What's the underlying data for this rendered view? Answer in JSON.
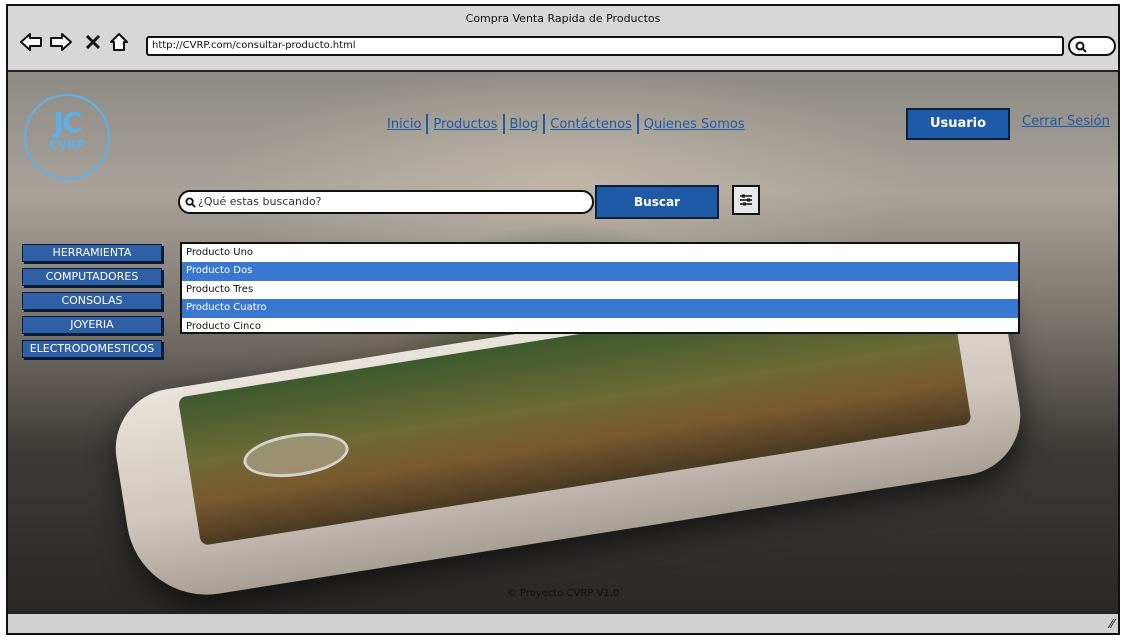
{
  "window": {
    "title": "Compra Venta Rapida de Productos"
  },
  "browser": {
    "url": "http://CVRP.com/consultar-producto.html",
    "icons": [
      "back-arrow-icon",
      "forward-arrow-icon",
      "close-x-icon",
      "home-icon",
      "search-icon"
    ]
  },
  "logo": {
    "mark": "JC",
    "text": "CVRP"
  },
  "nav": {
    "items": [
      "Inicio",
      "Productos",
      "Blog",
      "Contáctenos",
      "Quienes Somos"
    ],
    "user_button": "Usuario",
    "logout": "Cerrar Sesión"
  },
  "search": {
    "placeholder": "¿Qué estas buscando?",
    "button": "Buscar"
  },
  "categories": [
    "HERRAMIENTA",
    "COMPUTADORES",
    "CONSOLAS",
    "JOYERIA",
    "ELECTRODOMESTICOS"
  ],
  "products": [
    {
      "name": "Producto Uno",
      "selected": false
    },
    {
      "name": "Producto Dos",
      "selected": true
    },
    {
      "name": "Producto Tres",
      "selected": false
    },
    {
      "name": "Producto Cuatro",
      "selected": true
    },
    {
      "name": "Producto Cinco",
      "selected": false
    }
  ],
  "footer": {
    "text": "© Proyecto CVRP V1.0"
  },
  "colors": {
    "accent": "#1f5aa6",
    "selection": "#3a78d0",
    "logo": "#5fb0e8"
  }
}
